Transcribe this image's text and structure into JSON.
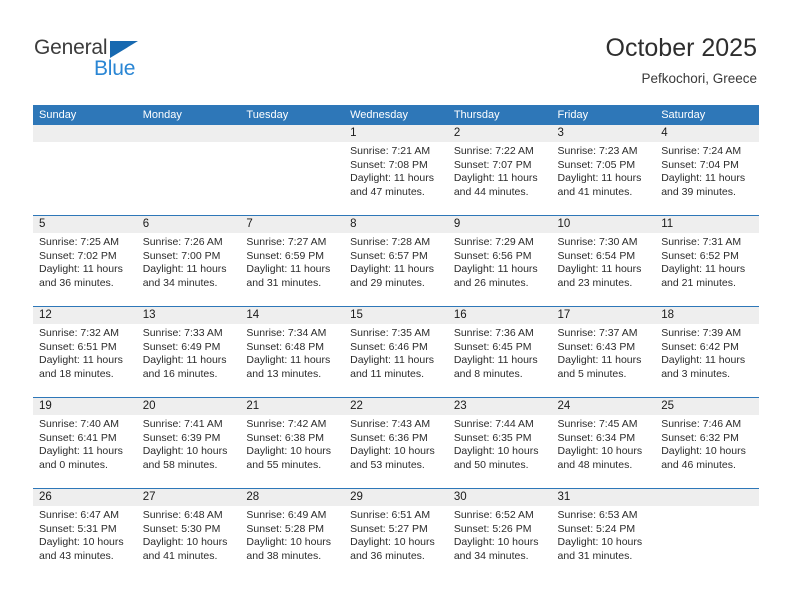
{
  "brand": {
    "word_one": "General",
    "word_two": "Blue",
    "triangle_color": "#1769b0",
    "blue_text_color": "#2a86d4"
  },
  "header": {
    "title": "October 2025",
    "subtitle": "Pefkochori, Greece"
  },
  "theme": {
    "header_bar_color": "#2e77b8",
    "daynum_band_color": "#eeeeee",
    "row_divider_color": "#2e77b8",
    "text_color": "#2b2b2b"
  },
  "calendar": {
    "day_headers": [
      "Sunday",
      "Monday",
      "Tuesday",
      "Wednesday",
      "Thursday",
      "Friday",
      "Saturday"
    ],
    "weeks": [
      [
        {
          "day": "",
          "empty": true
        },
        {
          "day": "",
          "empty": true
        },
        {
          "day": "",
          "empty": true
        },
        {
          "day": "1",
          "sunrise": "Sunrise: 7:21 AM",
          "sunset": "Sunset: 7:08 PM",
          "daylight_line1": "Daylight: 11 hours",
          "daylight_line2": "and 47 minutes."
        },
        {
          "day": "2",
          "sunrise": "Sunrise: 7:22 AM",
          "sunset": "Sunset: 7:07 PM",
          "daylight_line1": "Daylight: 11 hours",
          "daylight_line2": "and 44 minutes."
        },
        {
          "day": "3",
          "sunrise": "Sunrise: 7:23 AM",
          "sunset": "Sunset: 7:05 PM",
          "daylight_line1": "Daylight: 11 hours",
          "daylight_line2": "and 41 minutes."
        },
        {
          "day": "4",
          "sunrise": "Sunrise: 7:24 AM",
          "sunset": "Sunset: 7:04 PM",
          "daylight_line1": "Daylight: 11 hours",
          "daylight_line2": "and 39 minutes."
        }
      ],
      [
        {
          "day": "5",
          "sunrise": "Sunrise: 7:25 AM",
          "sunset": "Sunset: 7:02 PM",
          "daylight_line1": "Daylight: 11 hours",
          "daylight_line2": "and 36 minutes."
        },
        {
          "day": "6",
          "sunrise": "Sunrise: 7:26 AM",
          "sunset": "Sunset: 7:00 PM",
          "daylight_line1": "Daylight: 11 hours",
          "daylight_line2": "and 34 minutes."
        },
        {
          "day": "7",
          "sunrise": "Sunrise: 7:27 AM",
          "sunset": "Sunset: 6:59 PM",
          "daylight_line1": "Daylight: 11 hours",
          "daylight_line2": "and 31 minutes."
        },
        {
          "day": "8",
          "sunrise": "Sunrise: 7:28 AM",
          "sunset": "Sunset: 6:57 PM",
          "daylight_line1": "Daylight: 11 hours",
          "daylight_line2": "and 29 minutes."
        },
        {
          "day": "9",
          "sunrise": "Sunrise: 7:29 AM",
          "sunset": "Sunset: 6:56 PM",
          "daylight_line1": "Daylight: 11 hours",
          "daylight_line2": "and 26 minutes."
        },
        {
          "day": "10",
          "sunrise": "Sunrise: 7:30 AM",
          "sunset": "Sunset: 6:54 PM",
          "daylight_line1": "Daylight: 11 hours",
          "daylight_line2": "and 23 minutes."
        },
        {
          "day": "11",
          "sunrise": "Sunrise: 7:31 AM",
          "sunset": "Sunset: 6:52 PM",
          "daylight_line1": "Daylight: 11 hours",
          "daylight_line2": "and 21 minutes."
        }
      ],
      [
        {
          "day": "12",
          "sunrise": "Sunrise: 7:32 AM",
          "sunset": "Sunset: 6:51 PM",
          "daylight_line1": "Daylight: 11 hours",
          "daylight_line2": "and 18 minutes."
        },
        {
          "day": "13",
          "sunrise": "Sunrise: 7:33 AM",
          "sunset": "Sunset: 6:49 PM",
          "daylight_line1": "Daylight: 11 hours",
          "daylight_line2": "and 16 minutes."
        },
        {
          "day": "14",
          "sunrise": "Sunrise: 7:34 AM",
          "sunset": "Sunset: 6:48 PM",
          "daylight_line1": "Daylight: 11 hours",
          "daylight_line2": "and 13 minutes."
        },
        {
          "day": "15",
          "sunrise": "Sunrise: 7:35 AM",
          "sunset": "Sunset: 6:46 PM",
          "daylight_line1": "Daylight: 11 hours",
          "daylight_line2": "and 11 minutes."
        },
        {
          "day": "16",
          "sunrise": "Sunrise: 7:36 AM",
          "sunset": "Sunset: 6:45 PM",
          "daylight_line1": "Daylight: 11 hours",
          "daylight_line2": "and 8 minutes."
        },
        {
          "day": "17",
          "sunrise": "Sunrise: 7:37 AM",
          "sunset": "Sunset: 6:43 PM",
          "daylight_line1": "Daylight: 11 hours",
          "daylight_line2": "and 5 minutes."
        },
        {
          "day": "18",
          "sunrise": "Sunrise: 7:39 AM",
          "sunset": "Sunset: 6:42 PM",
          "daylight_line1": "Daylight: 11 hours",
          "daylight_line2": "and 3 minutes."
        }
      ],
      [
        {
          "day": "19",
          "sunrise": "Sunrise: 7:40 AM",
          "sunset": "Sunset: 6:41 PM",
          "daylight_line1": "Daylight: 11 hours",
          "daylight_line2": "and 0 minutes."
        },
        {
          "day": "20",
          "sunrise": "Sunrise: 7:41 AM",
          "sunset": "Sunset: 6:39 PM",
          "daylight_line1": "Daylight: 10 hours",
          "daylight_line2": "and 58 minutes."
        },
        {
          "day": "21",
          "sunrise": "Sunrise: 7:42 AM",
          "sunset": "Sunset: 6:38 PM",
          "daylight_line1": "Daylight: 10 hours",
          "daylight_line2": "and 55 minutes."
        },
        {
          "day": "22",
          "sunrise": "Sunrise: 7:43 AM",
          "sunset": "Sunset: 6:36 PM",
          "daylight_line1": "Daylight: 10 hours",
          "daylight_line2": "and 53 minutes."
        },
        {
          "day": "23",
          "sunrise": "Sunrise: 7:44 AM",
          "sunset": "Sunset: 6:35 PM",
          "daylight_line1": "Daylight: 10 hours",
          "daylight_line2": "and 50 minutes."
        },
        {
          "day": "24",
          "sunrise": "Sunrise: 7:45 AM",
          "sunset": "Sunset: 6:34 PM",
          "daylight_line1": "Daylight: 10 hours",
          "daylight_line2": "and 48 minutes."
        },
        {
          "day": "25",
          "sunrise": "Sunrise: 7:46 AM",
          "sunset": "Sunset: 6:32 PM",
          "daylight_line1": "Daylight: 10 hours",
          "daylight_line2": "and 46 minutes."
        }
      ],
      [
        {
          "day": "26",
          "sunrise": "Sunrise: 6:47 AM",
          "sunset": "Sunset: 5:31 PM",
          "daylight_line1": "Daylight: 10 hours",
          "daylight_line2": "and 43 minutes."
        },
        {
          "day": "27",
          "sunrise": "Sunrise: 6:48 AM",
          "sunset": "Sunset: 5:30 PM",
          "daylight_line1": "Daylight: 10 hours",
          "daylight_line2": "and 41 minutes."
        },
        {
          "day": "28",
          "sunrise": "Sunrise: 6:49 AM",
          "sunset": "Sunset: 5:28 PM",
          "daylight_line1": "Daylight: 10 hours",
          "daylight_line2": "and 38 minutes."
        },
        {
          "day": "29",
          "sunrise": "Sunrise: 6:51 AM",
          "sunset": "Sunset: 5:27 PM",
          "daylight_line1": "Daylight: 10 hours",
          "daylight_line2": "and 36 minutes."
        },
        {
          "day": "30",
          "sunrise": "Sunrise: 6:52 AM",
          "sunset": "Sunset: 5:26 PM",
          "daylight_line1": "Daylight: 10 hours",
          "daylight_line2": "and 34 minutes."
        },
        {
          "day": "31",
          "sunrise": "Sunrise: 6:53 AM",
          "sunset": "Sunset: 5:24 PM",
          "daylight_line1": "Daylight: 10 hours",
          "daylight_line2": "and 31 minutes."
        },
        {
          "day": "",
          "empty": true
        }
      ]
    ]
  }
}
